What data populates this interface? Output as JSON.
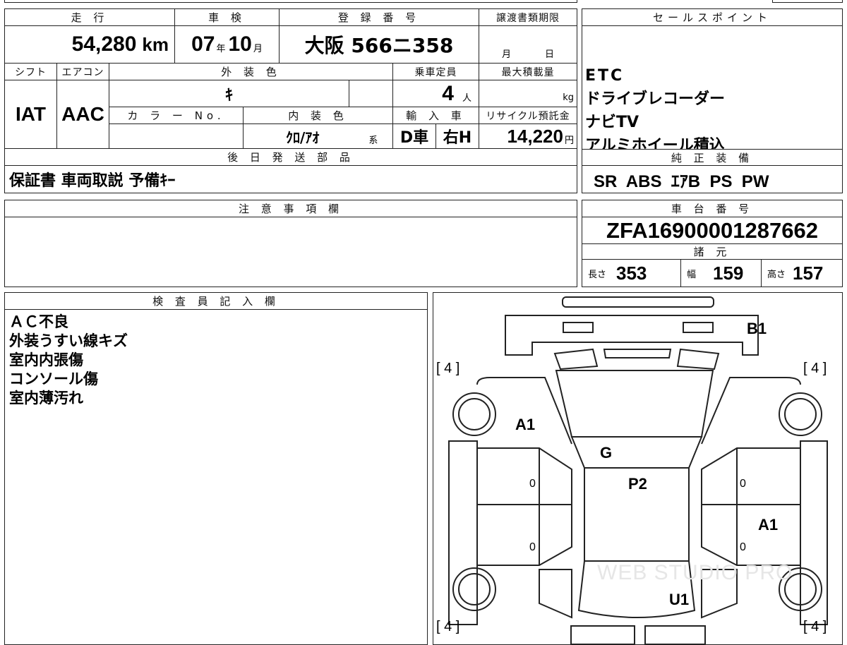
{
  "top_row": {
    "mileage_header": "走 行",
    "mileage_value": "54,280",
    "mileage_unit": "km",
    "inspection_header": "車 検",
    "inspection_year": "07",
    "inspection_year_unit": "年",
    "inspection_month": "10",
    "inspection_month_unit": "月",
    "registration_header": "登 録 番 号",
    "registration_value": "大阪 566ニ358",
    "transfer_header": "譲渡書類期限",
    "transfer_month_unit": "月",
    "transfer_day_unit": "日"
  },
  "second_row": {
    "shift_header": "シフト",
    "shift_value": "IAT",
    "aircon_header": "エアコン",
    "aircon_value": "AAC",
    "exterior_header": "外 装 色",
    "exterior_value": "ｷ",
    "capacity_header": "乗車定員",
    "capacity_value": "4",
    "capacity_unit": "人",
    "maxload_header": "最大積載量",
    "maxload_unit": "kg",
    "colorno_header": "カ ラ ー No.",
    "interior_header": "内 装 色",
    "interior_value": "ｸﾛ/ｱｵ",
    "interior_suffix": "系",
    "import_header": "輸 入 車",
    "import_value1": "D車",
    "import_value2": "右H",
    "recycle_header": "リサイクル預託金",
    "recycle_value": "14,220",
    "recycle_unit": "円"
  },
  "later_parts": {
    "header": "後 日 発 送 部 品",
    "value": "保証書 車両取説 予備ｷｰ"
  },
  "sales_points": {
    "header": "セールスポイント",
    "items": [
      "ETC",
      "ドライブレコーダー",
      "ナビTV",
      "アルミホイール積込"
    ]
  },
  "genuine_equipment": {
    "header": "純 正 装 備",
    "value": "SR  ABS  ｴｱB  PS  PW"
  },
  "notes": {
    "header": "注 意 事 項 欄",
    "value": ""
  },
  "chassis": {
    "header": "車 台 番 号",
    "value": "ZFA16900001287662",
    "spec_header": "諸 元",
    "length_label": "長さ",
    "length_value": "353",
    "width_label": "幅",
    "width_value": "159",
    "height_label": "高さ",
    "height_value": "157"
  },
  "inspector": {
    "header": "検 査 員 記 入 欄",
    "lines": [
      "ＡＣ不良",
      "外装うすい線キズ",
      "室内内張傷",
      "コンソール傷",
      "室内薄汚れ"
    ]
  },
  "diagram": {
    "tire_top_left": "[ 4 ]",
    "tire_top_right": "[ 4 ]",
    "tire_bottom_left": "[ 4 ]",
    "tire_bottom_right": "[ 4 ]",
    "mark_b1": "B1",
    "mark_a1_left": "A1",
    "mark_g": "G",
    "mark_p2": "P2",
    "mark_a1_right": "A1",
    "mark_u1": "U1",
    "zero": "0",
    "watermark": "WEB STUDIO PRO"
  }
}
